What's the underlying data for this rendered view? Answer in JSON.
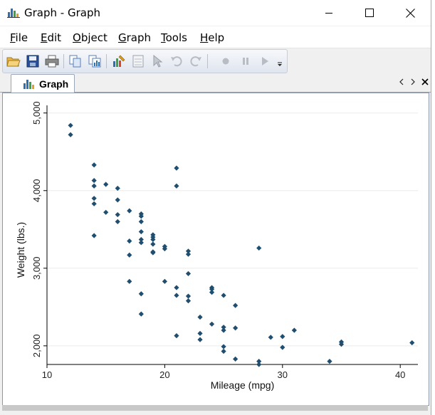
{
  "window": {
    "title": "Graph - Graph",
    "controls": {
      "minimize": "minimize",
      "maximize": "maximize",
      "close": "close"
    }
  },
  "menu": {
    "items": [
      {
        "label": "File",
        "accel": "F",
        "rest": "ile"
      },
      {
        "label": "Edit",
        "accel": "E",
        "rest": "dit"
      },
      {
        "label": "Object",
        "accel": "O",
        "rest": "bject"
      },
      {
        "label": "Graph",
        "accel": "G",
        "rest": "raph"
      },
      {
        "label": "Tools",
        "accel": "T",
        "rest": "ools"
      },
      {
        "label": "Help",
        "accel": "H",
        "rest": "elp"
      }
    ]
  },
  "toolbar": {
    "buttons": [
      "open-icon",
      "save-icon",
      "print-icon",
      "copy-icon",
      "copy-graph-icon",
      "graph-editor-icon",
      "data-editor-icon",
      "pointer-icon",
      "undo-icon",
      "redo-icon",
      "record-icon",
      "pause-icon",
      "play-icon",
      "overflow-icon"
    ]
  },
  "tab": {
    "label": "Graph"
  },
  "colors": {
    "marker": "#1f4e6f",
    "grid": "#ebebeb",
    "axis": "#000000"
  },
  "chart_data": {
    "type": "scatter",
    "title": "",
    "xlabel": "Mileage (mpg)",
    "ylabel": "Weight (lbs.)",
    "xlim": [
      10,
      41.5
    ],
    "ylim": [
      1760,
      5080
    ],
    "xticks": [
      10,
      20,
      30,
      40
    ],
    "yticks": [
      2000,
      3000,
      4000,
      5000
    ],
    "xtick_labels": [
      "10",
      "20",
      "30",
      "40"
    ],
    "ytick_labels": [
      "2,000",
      "3,000",
      "4,000",
      "5,000"
    ],
    "grid": "horizontal",
    "legend": "none",
    "points": [
      [
        12,
        4840
      ],
      [
        12,
        4720
      ],
      [
        14,
        4330
      ],
      [
        14,
        4130
      ],
      [
        14,
        4060
      ],
      [
        14,
        3900
      ],
      [
        14,
        3830
      ],
      [
        14,
        3420
      ],
      [
        15,
        4080
      ],
      [
        15,
        3720
      ],
      [
        16,
        4030
      ],
      [
        16,
        3880
      ],
      [
        16,
        3690
      ],
      [
        16,
        3600
      ],
      [
        17,
        3740
      ],
      [
        17,
        3350
      ],
      [
        17,
        3170
      ],
      [
        17,
        2830
      ],
      [
        18,
        3700
      ],
      [
        18,
        3670
      ],
      [
        18,
        3600
      ],
      [
        18,
        3470
      ],
      [
        18,
        3370
      ],
      [
        18,
        3330
      ],
      [
        18,
        2670
      ],
      [
        18,
        2410
      ],
      [
        19,
        3430
      ],
      [
        19,
        3400
      ],
      [
        19,
        3370
      ],
      [
        19,
        3310
      ],
      [
        19,
        3210
      ],
      [
        19,
        3200
      ],
      [
        20,
        3280
      ],
      [
        20,
        3250
      ],
      [
        20,
        2830
      ],
      [
        21,
        4290
      ],
      [
        21,
        4060
      ],
      [
        21,
        2750
      ],
      [
        21,
        2650
      ],
      [
        21,
        2130
      ],
      [
        22,
        3220
      ],
      [
        22,
        3180
      ],
      [
        22,
        2930
      ],
      [
        22,
        2640
      ],
      [
        22,
        2580
      ],
      [
        23,
        2370
      ],
      [
        23,
        2160
      ],
      [
        23,
        2080
      ],
      [
        24,
        2750
      ],
      [
        24,
        2730
      ],
      [
        24,
        2690
      ],
      [
        24,
        2280
      ],
      [
        25,
        2650
      ],
      [
        25,
        2240
      ],
      [
        25,
        2200
      ],
      [
        25,
        1990
      ],
      [
        25,
        1930
      ],
      [
        26,
        2520
      ],
      [
        26,
        2230
      ],
      [
        26,
        1830
      ],
      [
        28,
        3260
      ],
      [
        28,
        1800
      ],
      [
        28,
        1760
      ],
      [
        29,
        2110
      ],
      [
        30,
        2120
      ],
      [
        30,
        1980
      ],
      [
        31,
        2200
      ],
      [
        34,
        1800
      ],
      [
        35,
        2050
      ],
      [
        35,
        2020
      ],
      [
        41,
        2040
      ]
    ]
  }
}
